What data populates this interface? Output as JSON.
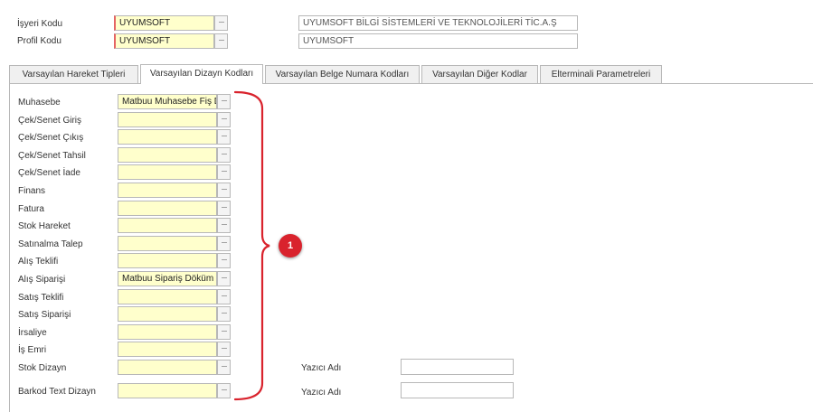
{
  "header": {
    "isyeri_label": "İşyeri Kodu",
    "isyeri_value": "UYUMSOFT",
    "isyeri_desc": "UYUMSOFT BİLGİ SİSTEMLERİ VE TEKNOLOJİLERİ TİC.A.Ş",
    "profil_label": "Profil Kodu",
    "profil_value": "UYUMSOFT",
    "profil_desc": "UYUMSOFT"
  },
  "tabs": [
    {
      "label": "Varsayılan Hareket Tipleri"
    },
    {
      "label": "Varsayılan Dizayn Kodları",
      "active": true
    },
    {
      "label": "Varsayılan Belge Numara Kodları"
    },
    {
      "label": "Varsayılan Diğer Kodlar"
    },
    {
      "label": "Elterminali Parametreleri"
    }
  ],
  "form": {
    "rows": [
      {
        "label": "Muhasebe",
        "value": "Matbuu Muhasebe Fiş D"
      },
      {
        "label": "Çek/Senet Giriş",
        "value": ""
      },
      {
        "label": "Çek/Senet Çıkış",
        "value": ""
      },
      {
        "label": "Çek/Senet Tahsil",
        "value": ""
      },
      {
        "label": "Çek/Senet İade",
        "value": ""
      },
      {
        "label": "Finans",
        "value": ""
      },
      {
        "label": "Fatura",
        "value": ""
      },
      {
        "label": "Stok Hareket",
        "value": ""
      },
      {
        "label": "Satınalma Talep",
        "value": ""
      },
      {
        "label": "Alış Teklifi",
        "value": ""
      },
      {
        "label": "Alış Siparişi",
        "value": "Matbuu Sipariş Döküm"
      },
      {
        "label": "Satış Teklifi",
        "value": ""
      },
      {
        "label": "Satış Siparişi",
        "value": ""
      },
      {
        "label": "İrsaliye",
        "value": ""
      },
      {
        "label": "İş Emri",
        "value": ""
      },
      {
        "label": "Stok Dizayn",
        "value": ""
      },
      {
        "label": "Barkod Text Dizayn",
        "value": ""
      }
    ],
    "lookup_glyph": "···",
    "printer_label": "Yazıcı Adı",
    "printer_stok_value": "",
    "printer_barkod_value": ""
  },
  "annotation": {
    "number": "1",
    "color": "#d9232d"
  }
}
